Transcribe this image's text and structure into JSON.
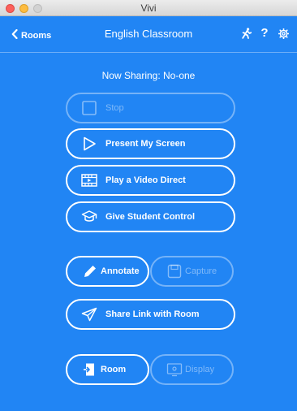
{
  "window": {
    "title": "Vivi"
  },
  "nav": {
    "back_label": "Rooms",
    "title": "English Classroom",
    "icons": [
      "back-chevron-icon",
      "run-icon",
      "help-icon",
      "settings-gear-icon"
    ],
    "help_glyph": "?"
  },
  "status": {
    "sharing_text": "Now Sharing: No-one"
  },
  "actions": {
    "stop": "Stop",
    "present": "Present My Screen",
    "video": "Play a Video Direct",
    "control": "Give Student Control",
    "annotate": "Annotate",
    "capture": "Capture",
    "share_link": "Share Link with Room",
    "room": "Room",
    "display": "Display"
  },
  "colors": {
    "background": "#2185f4",
    "button_border": "#ffffff",
    "titlebar": "#e4e4e4"
  }
}
